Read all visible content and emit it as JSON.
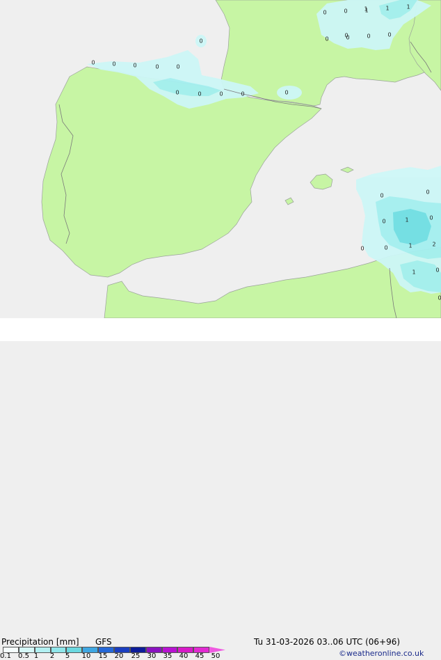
{
  "map": {
    "colors": {
      "sea": "#efefef",
      "land": "#c7f5a4",
      "precip_light": "#cdf7f7",
      "precip_mid": "#a4eff0",
      "precip_heavy": "#6fdfe3",
      "border": "#7a7a7a",
      "coast": "#9aa29a"
    },
    "point_values": [
      {
        "v": "0"
      },
      {
        "v": "0"
      },
      {
        "v": "1"
      },
      {
        "v": "1"
      },
      {
        "v": "1"
      },
      {
        "v": "0"
      },
      {
        "v": "0"
      },
      {
        "v": "0"
      },
      {
        "v": "0"
      },
      {
        "v": "0"
      },
      {
        "v": "0"
      },
      {
        "v": "0"
      },
      {
        "v": "0"
      },
      {
        "v": "0"
      },
      {
        "v": "0"
      },
      {
        "v": "0"
      },
      {
        "v": "0"
      },
      {
        "v": "0"
      },
      {
        "v": "0"
      },
      {
        "v": "0"
      },
      {
        "v": "0"
      },
      {
        "v": "0"
      },
      {
        "v": "0"
      },
      {
        "v": "0"
      },
      {
        "v": "1"
      },
      {
        "v": "0"
      },
      {
        "v": "0"
      },
      {
        "v": "1"
      },
      {
        "v": "2"
      },
      {
        "v": "1"
      },
      {
        "v": "0"
      },
      {
        "v": "0"
      },
      {
        "v": "0"
      },
      {
        "v": "1"
      }
    ]
  },
  "footer": {
    "title": "Precipitation [mm]",
    "model": "GFS",
    "datetime": "Tu 31-03-2026 03..06 UTC (06+96)",
    "credit": "©weatheronline.co.uk",
    "scale": {
      "labels": [
        "0.1",
        "0.5",
        "1",
        "2",
        "5",
        "10",
        "15",
        "20",
        "25",
        "30",
        "35",
        "40",
        "45",
        "50"
      ],
      "colors": [
        "#f5fdfd",
        "#d5f7f7",
        "#b2f0f2",
        "#8fe6ea",
        "#6bd8e0",
        "#3fa7e2",
        "#2468d8",
        "#1a3ec0",
        "#0c1c9a",
        "#8a12c0",
        "#b812d2",
        "#d81ac8",
        "#e22ad2",
        "#ef5ae0"
      ]
    }
  }
}
